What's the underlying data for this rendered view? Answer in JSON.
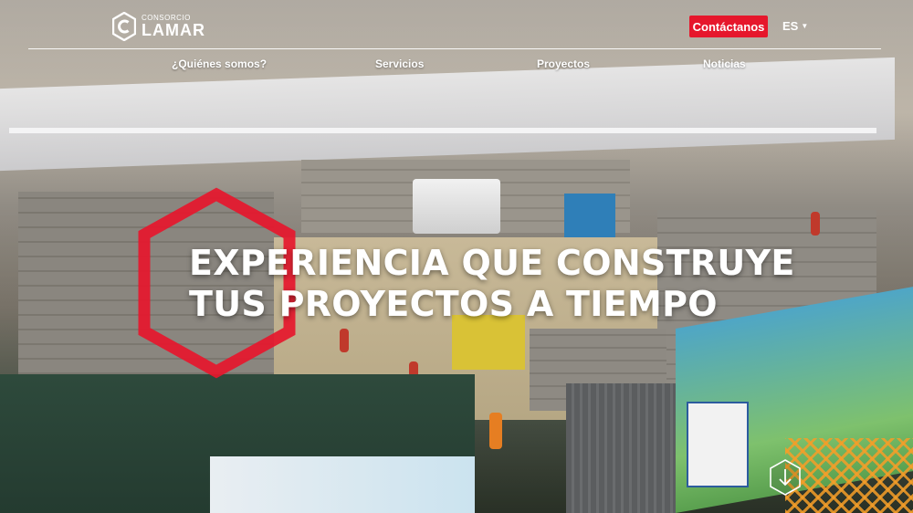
{
  "logo": {
    "small": "CONSORCIO",
    "name": "LAMAR",
    "icon": "hexagon-c-logo"
  },
  "header": {
    "contact_label": "Contáctanos",
    "contact_color": "#e6172c",
    "language": "ES",
    "language_icon": "caret-down-icon"
  },
  "nav": {
    "items": [
      {
        "label": "¿Quiénes somos?"
      },
      {
        "label": "Servicios"
      },
      {
        "label": "Proyectos"
      },
      {
        "label": "Noticias"
      }
    ]
  },
  "hero": {
    "headline_line1": "EXPERIENCIA QUE CONSTRUYE",
    "headline_line2": "TUS PROYECTOS A TIEMPO",
    "accent_color": "#e6172c",
    "scroll_icon": "arrow-down-hexagon-icon"
  }
}
